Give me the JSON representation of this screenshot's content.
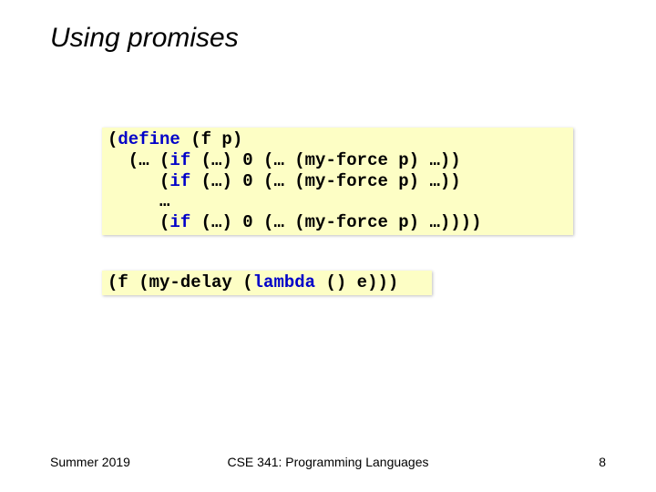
{
  "title": "Using promises",
  "code1": {
    "kw_define": "define",
    "t1": " (f p)",
    "t2": "  (… (",
    "kw_if1": "if",
    "t3": " (…) 0 (… (my-force p) …))",
    "t4": "     (",
    "kw_if2": "if",
    "t5": " (…) 0 (… (my-force p) …))",
    "t6": "     …",
    "t7": "     (",
    "kw_if3": "if",
    "t8": " (…) 0 (… (my-force p) …))))"
  },
  "code2": {
    "t1": "(f (my-delay (",
    "kw_lambda": "lambda",
    "t2": " () e)))"
  },
  "footer": {
    "left": "Summer 2019",
    "center": "CSE 341: Programming Languages",
    "right": "8"
  }
}
